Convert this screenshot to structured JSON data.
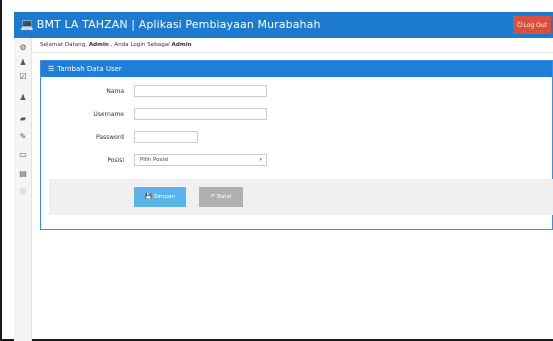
{
  "header": {
    "app_icon": "laptop-icon",
    "title": "BMT LA TAHZAN | Aplikasi Pembiayaan Murabahah",
    "logout_icon": "power-icon",
    "logout_label": "Log Out"
  },
  "sidebar": {
    "items": [
      {
        "icon": "dashboard-icon",
        "glyph": "⚙"
      },
      {
        "icon": "user-icon",
        "glyph": "♟"
      },
      {
        "icon": "check-icon",
        "glyph": "☑"
      },
      {
        "icon": "user-icon",
        "glyph": "♟"
      },
      {
        "icon": "book-icon",
        "glyph": "▰"
      },
      {
        "icon": "edit-icon",
        "glyph": "✎"
      },
      {
        "icon": "card-icon",
        "glyph": "▭"
      },
      {
        "icon": "list-icon",
        "glyph": "▤"
      },
      {
        "icon": "circle-arrow-icon",
        "glyph": "◎"
      }
    ]
  },
  "welcome": {
    "prefix": "Selamat Datang, ",
    "user": "Admin",
    "middle": " , Anda Login Sebagai ",
    "role": "Admin"
  },
  "panel": {
    "icon": "list-icon",
    "title": "Tambah Data User"
  },
  "form": {
    "nama_label": "Nama",
    "nama_value": "",
    "username_label": "Username",
    "username_value": "",
    "password_label": "Password",
    "password_value": "",
    "posisi_label": "Posisi",
    "posisi_selected": "Pilih Posisi"
  },
  "buttons": {
    "save_icon": "floppy-icon",
    "save_label": "Simpan",
    "cancel_icon": "undo-icon",
    "cancel_label": "Batal"
  },
  "colors": {
    "topbar": "#1d7bcf",
    "logout": "#d9503f",
    "panel_header": "#1e7ed8",
    "save_button": "#5bb4e8",
    "cancel_button": "#b0b0b0"
  }
}
